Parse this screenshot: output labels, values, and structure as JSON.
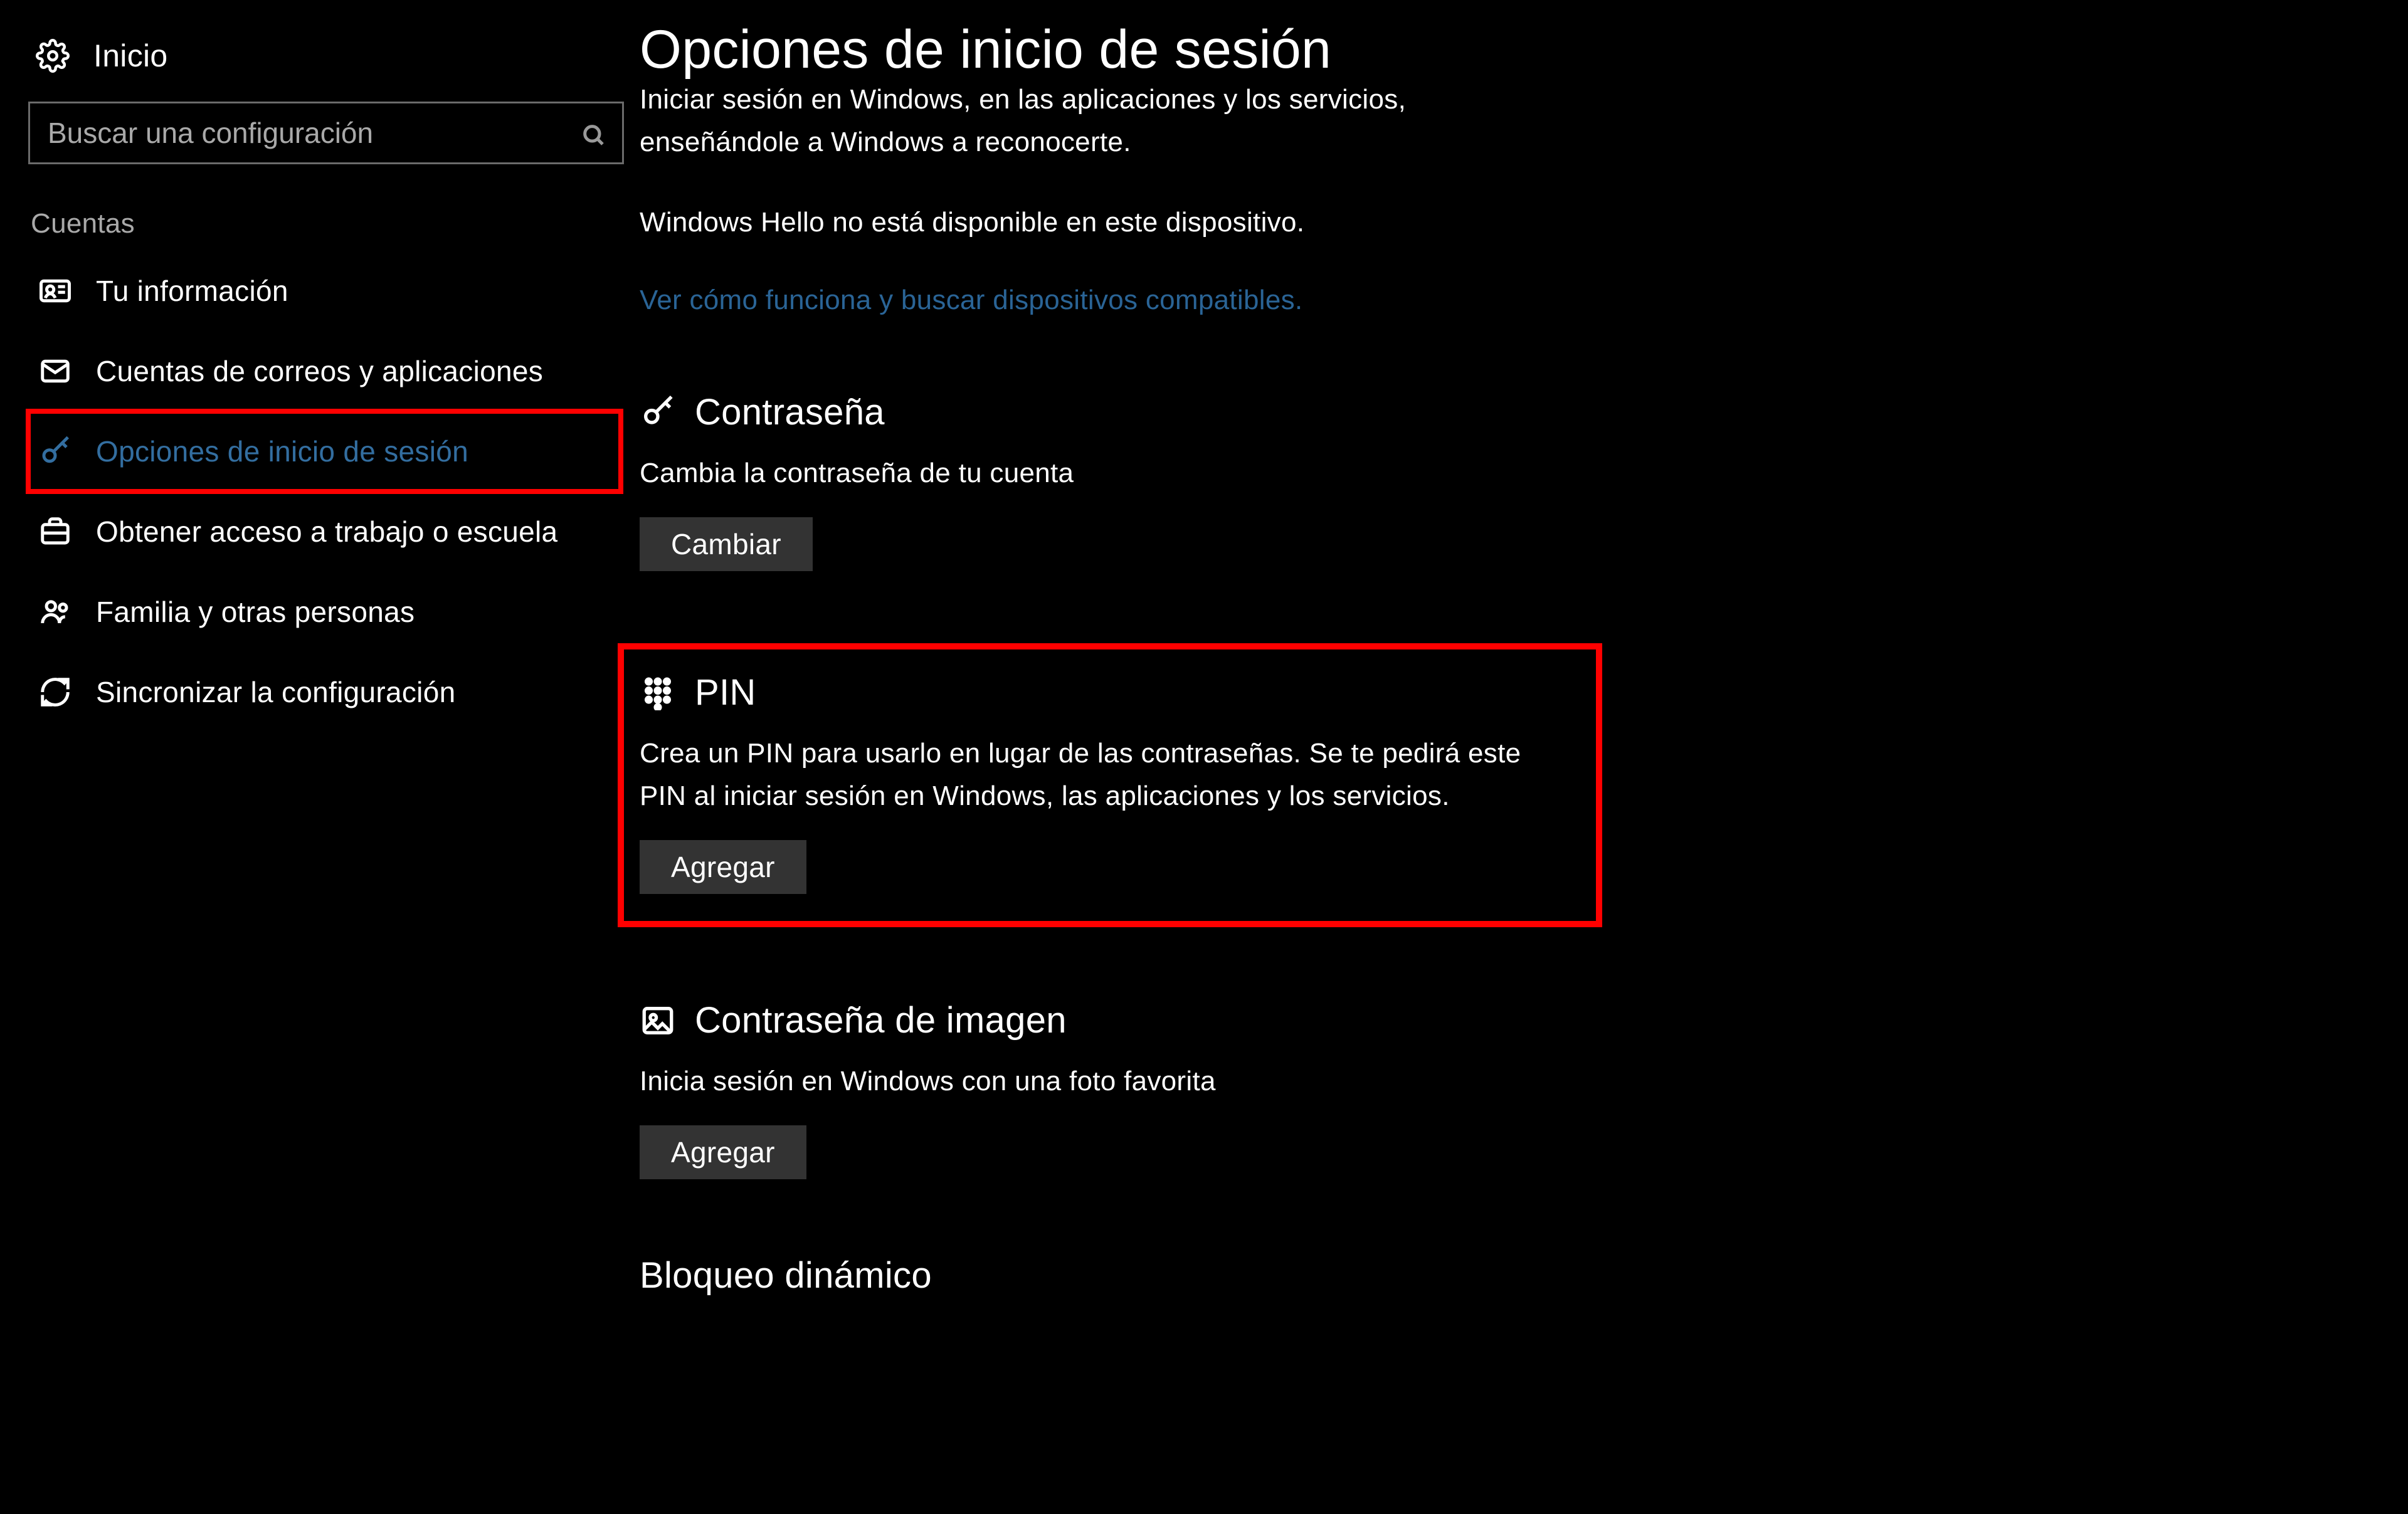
{
  "nav": {
    "home": "Inicio",
    "search_placeholder": "Buscar una configuración",
    "category": "Cuentas",
    "items": [
      {
        "label": "Tu información",
        "selected": false
      },
      {
        "label": "Cuentas de correos y aplicaciones",
        "selected": false
      },
      {
        "label": "Opciones de inicio de sesión",
        "selected": true
      },
      {
        "label": "Obtener acceso a trabajo o escuela",
        "selected": false
      },
      {
        "label": "Familia y otras personas",
        "selected": false
      },
      {
        "label": "Sincronizar la configuración",
        "selected": false
      }
    ]
  },
  "main": {
    "title": "Opciones de inicio de sesión",
    "intro_line1": "Iniciar sesión en Windows, en las aplicaciones y los servicios,",
    "intro_line2": "enseñándole a Windows a reconocerte.",
    "hello_unavailable": "Windows Hello no está disponible en este dispositivo.",
    "hello_link": "Ver cómo funciona y buscar dispositivos compatibles.",
    "password": {
      "heading": "Contraseña",
      "desc": "Cambia la contraseña de tu cuenta",
      "button": "Cambiar"
    },
    "pin": {
      "heading": "PIN",
      "desc": "Crea un PIN para usarlo en lugar de las contraseñas. Se te pedirá este PIN al iniciar sesión en Windows, las aplicaciones y los servicios.",
      "button": "Agregar"
    },
    "picture": {
      "heading": "Contraseña de imagen",
      "desc": "Inicia sesión en Windows con una foto favorita",
      "button": "Agregar"
    },
    "dynlock": {
      "heading": "Bloqueo dinámico"
    }
  }
}
